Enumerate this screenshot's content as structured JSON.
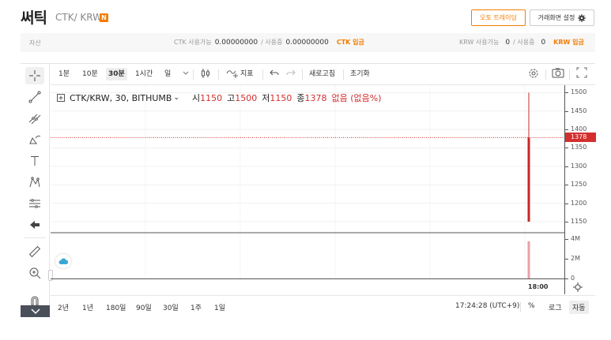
{
  "header": {
    "coin_name": "써틱",
    "pair": "CTK/ KRW",
    "new_badge": "N",
    "auto_trade_label": "오토 트레이딩",
    "screen_setting_label": "거래화면 설정"
  },
  "assets": {
    "label": "자산",
    "ctk_prefix": "CTK 사용가능",
    "ctk_available": "0.00000000",
    "ctk_sep": "/ 사용중",
    "ctk_in_use": "0.00000000",
    "ctk_deposit": "CTK 입금",
    "krw_prefix": "KRW 사용가능",
    "krw_available": "0",
    "krw_sep": "/ 사용중",
    "krw_in_use": "0",
    "krw_deposit": "KRW 입금"
  },
  "toolbar": {
    "intervals": [
      "1분",
      "10분",
      "30분",
      "1시간",
      "일"
    ],
    "active_interval": "30분",
    "indicator_label": "지표",
    "refresh_label": "새로고침",
    "reset_label": "초기화"
  },
  "legend": {
    "symbol": "CTK/KRW, 30, BITHUMB",
    "open_label": "시",
    "open": "1150",
    "high_label": "고",
    "high": "1500",
    "low_label": "저",
    "low": "1150",
    "close_label": "종",
    "close": "1378",
    "change": "없음 (없음%)"
  },
  "chart_data": {
    "type": "candlestick",
    "symbol": "CTK/KRW",
    "interval": "30",
    "exchange": "BITHUMB",
    "candles": [
      {
        "time": "18:00",
        "open": 1378,
        "high": 1500,
        "low": 1150,
        "close": 1150,
        "volume": 3800000
      }
    ],
    "current_price": 1378,
    "price_ticks": [
      "1500",
      "1450",
      "1400",
      "1350",
      "1300",
      "1250",
      "1200",
      "1150"
    ],
    "volume_ticks": [
      "4M",
      "2M",
      "0"
    ],
    "time_ticks": [
      "18:00"
    ],
    "price_range": [
      1120,
      1520
    ],
    "volume_range": [
      0,
      4600000
    ],
    "colors": {
      "down": "#c62828",
      "volume": "#e8a0a6",
      "current_line": "#d32f2f"
    }
  },
  "bottom": {
    "ranges": [
      "2년",
      "1년",
      "180일",
      "90일",
      "30일",
      "1주",
      "1일"
    ],
    "clock": "17:24:28 (UTC+9)",
    "percent_label": "%",
    "log_label": "로그",
    "auto_label": "자동"
  },
  "icons": {
    "crosshair": "crosshair-icon",
    "trendline": "trend-line-icon",
    "fib": "fib-icon",
    "brush": "brush-icon",
    "text": "text-icon",
    "pattern": "pattern-icon",
    "measure": "measure-icon",
    "back": "arrow-left-icon",
    "ruler": "ruler-icon",
    "zoom": "zoom-in-icon",
    "magnet": "magnet-icon"
  }
}
